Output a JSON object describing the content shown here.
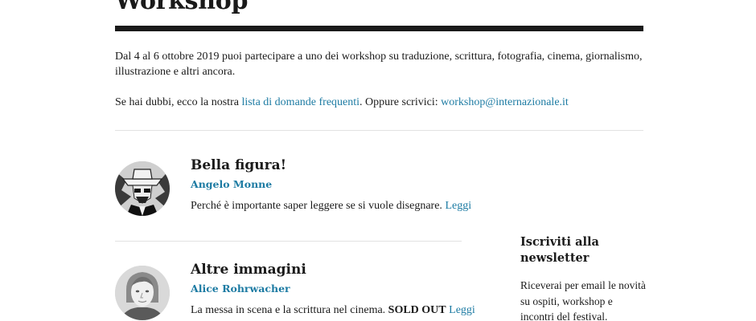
{
  "page": {
    "title": "Workshop"
  },
  "intro": {
    "text": "Dal 4 al 6 ottobre 2019 puoi partecipare a uno dei workshop su traduzione, scrittura, fotografia, cinema, giornalismo, illustrazione e altri ancora."
  },
  "contact": {
    "prefix": "Se hai dubbi, ecco la nostra ",
    "faq_link": "lista di domande frequenti",
    "middle": ". Oppure scrivici: ",
    "email_link": "workshop@internazionale.it"
  },
  "workshops": [
    {
      "title": "Bella figura!",
      "author": "Angelo Monne",
      "description": "Perché è importante saper leggere se si vuole disegnare. ",
      "badge": "",
      "read_more": "Leggi",
      "avatar_icon": "illustrated-portrait-icon"
    },
    {
      "title": "Altre immagini",
      "author": "Alice Rohrwacher",
      "description": "La messa in scena e la scrittura nel cinema. ",
      "badge": "SOLD OUT",
      "read_more": "Leggi",
      "avatar_icon": "portrait-photo-icon"
    }
  ],
  "newsletter": {
    "title": "Iscriviti alla newsletter",
    "text": "Riceverai per email le novità su ospiti, workshop e incontri del festival."
  },
  "colors": {
    "link": "#1d7ba3",
    "text": "#1a1a1a",
    "rule": "#1a1a1a",
    "divider": "#e2e2e2"
  }
}
